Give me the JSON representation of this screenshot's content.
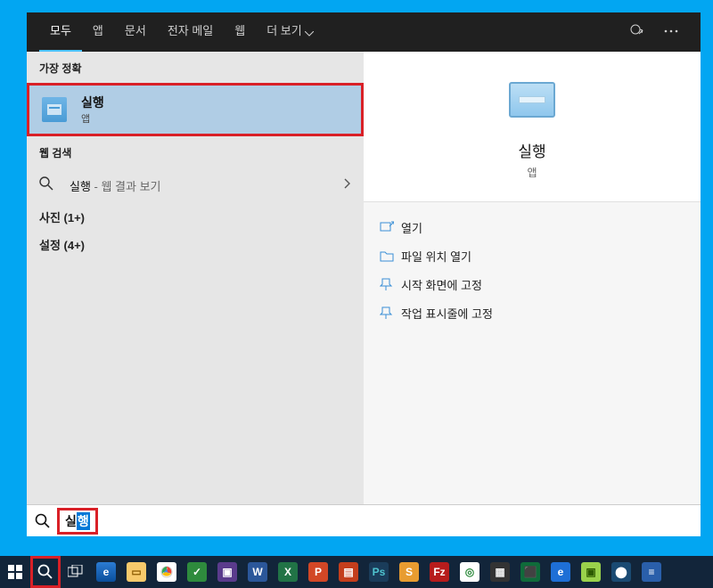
{
  "tabs": {
    "all": "모두",
    "apps": "앱",
    "docs": "문서",
    "email": "전자 메일",
    "web": "웹",
    "more": "더 보기"
  },
  "left": {
    "best_match_label": "가장 정확",
    "best_title": "실행",
    "best_sub": "앱",
    "web_label": "웹 검색",
    "web_text": "실행",
    "web_hint": " - 웹 결과 보기",
    "photos": "사진 (1+)",
    "settings": "설정 (4+)"
  },
  "detail": {
    "title": "실행",
    "sub": "앱",
    "actions": {
      "open": "열기",
      "open_location": "파일 위치 열기",
      "pin_start": "시작 화면에 고정",
      "pin_taskbar": "작업 표시줄에 고정"
    }
  },
  "search": {
    "plain": "실",
    "selected": "행"
  }
}
